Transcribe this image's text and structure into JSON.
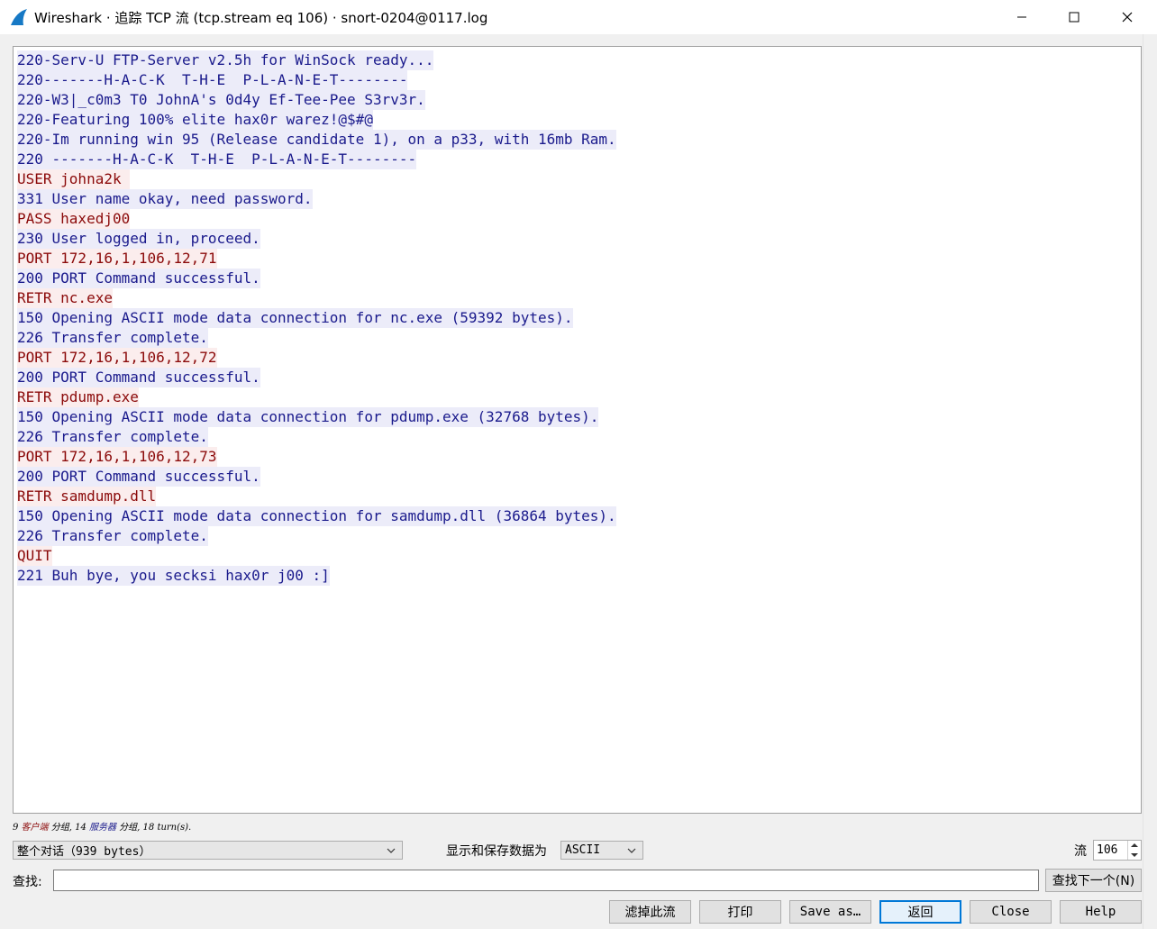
{
  "window": {
    "title": "Wireshark · 追踪 TCP 流 (tcp.stream eq 106) · snort-0204@0117.log",
    "minimize_glyph": "—",
    "maximize_glyph": "☐",
    "close_glyph": "✕"
  },
  "colors": {
    "client_text": "#8b0a0a",
    "client_bg": "#fbeded",
    "server_text": "#1a1a8c",
    "server_bg": "#ececf9",
    "accent": "#0078d7"
  },
  "stream": {
    "lines": [
      {
        "dir": "server",
        "text": "220-Serv-U FTP-Server v2.5h for WinSock ready..."
      },
      {
        "dir": "server",
        "text": "220-------H-A-C-K  T-H-E  P-L-A-N-E-T--------"
      },
      {
        "dir": "server",
        "text": "220-W3|_c0m3 T0 JohnA's 0d4y Ef-Tee-Pee S3rv3r."
      },
      {
        "dir": "server",
        "text": "220-Featuring 100% elite hax0r warez!@$#@"
      },
      {
        "dir": "server",
        "text": "220-Im running win 95 (Release candidate 1), on a p33, with 16mb Ram."
      },
      {
        "dir": "server",
        "text": "220 -------H-A-C-K  T-H-E  P-L-A-N-E-T--------"
      },
      {
        "dir": "client",
        "text": "USER johna2k "
      },
      {
        "dir": "server",
        "text": "331 User name okay, need password."
      },
      {
        "dir": "client",
        "text": "PASS haxedj00"
      },
      {
        "dir": "server",
        "text": "230 User logged in, proceed."
      },
      {
        "dir": "client",
        "text": "PORT 172,16,1,106,12,71"
      },
      {
        "dir": "server",
        "text": "200 PORT Command successful."
      },
      {
        "dir": "client",
        "text": "RETR nc.exe"
      },
      {
        "dir": "server",
        "text": "150 Opening ASCII mode data connection for nc.exe (59392 bytes)."
      },
      {
        "dir": "server",
        "text": "226 Transfer complete."
      },
      {
        "dir": "client",
        "text": "PORT 172,16,1,106,12,72"
      },
      {
        "dir": "server",
        "text": "200 PORT Command successful."
      },
      {
        "dir": "client",
        "text": "RETR pdump.exe"
      },
      {
        "dir": "server",
        "text": "150 Opening ASCII mode data connection for pdump.exe (32768 bytes)."
      },
      {
        "dir": "server",
        "text": "226 Transfer complete."
      },
      {
        "dir": "client",
        "text": "PORT 172,16,1,106,12,73"
      },
      {
        "dir": "server",
        "text": "200 PORT Command successful."
      },
      {
        "dir": "client",
        "text": "RETR samdump.dll"
      },
      {
        "dir": "server",
        "text": "150 Opening ASCII mode data connection for samdump.dll (36864 bytes)."
      },
      {
        "dir": "server",
        "text": "226 Transfer complete."
      },
      {
        "dir": "client",
        "text": "QUIT"
      },
      {
        "dir": "server",
        "text": "221 Buh bye, you secksi hax0r j00 :]"
      }
    ]
  },
  "stats": {
    "client_count": "9 ",
    "client_word": "客户端",
    "mid": " 分组, 14 ",
    "server_word": "服务器",
    "tail": " 分组, 18 turn(s)."
  },
  "controls": {
    "conversation_select": "整个对话（939 bytes）",
    "show_save_label": "显示和保存数据为",
    "format_select": "ASCII",
    "stream_label": "流",
    "stream_value": "106",
    "find_label": "查找:",
    "find_value": "",
    "find_next": "查找下一个(N)"
  },
  "buttons": {
    "filter_out": "滤掉此流",
    "print": "打印",
    "save_as": "Save as…",
    "back": "返回",
    "close": "Close",
    "help": "Help"
  },
  "icons": {
    "app": "wireshark-fin-icon",
    "dropdown": "chevron-down-icon"
  }
}
